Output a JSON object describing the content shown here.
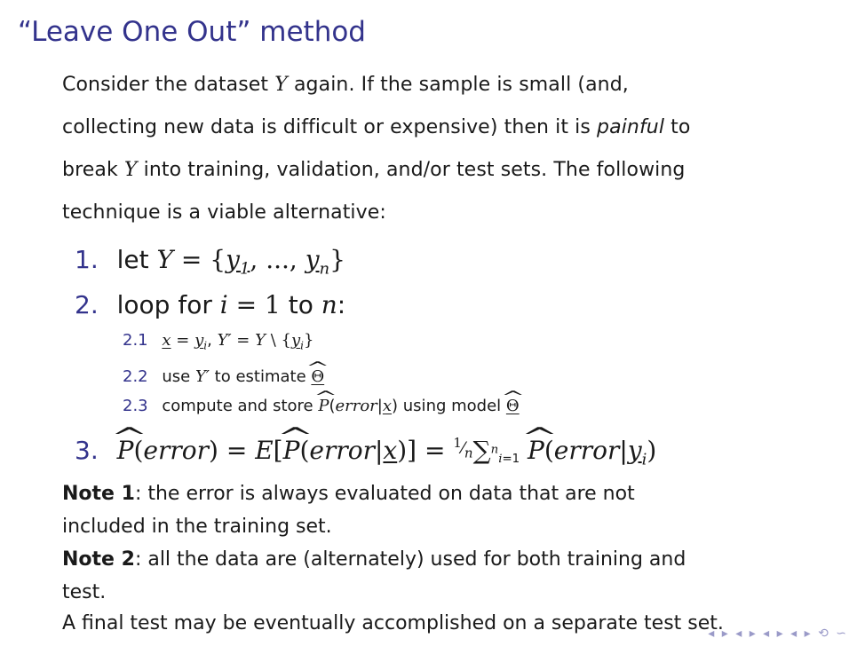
{
  "slide": {
    "title": "“Leave One Out” method",
    "intro_lines": [
      "Consider the dataset Y again. If the sample is small (and,",
      "collecting new data is difficult or expensive) then it is painful to",
      "break Y into training, validation, and/or test sets. The following",
      "technique is a viable alternative:"
    ],
    "steps": [
      {
        "number": "1.",
        "text_prefix": "let",
        "formula": "Y = {y1, ..., yn}"
      },
      {
        "number": "2.",
        "text_prefix": "loop for",
        "formula": "i = 1 to n:"
      },
      {
        "number": "3.",
        "text_prefix": "",
        "formula": "P̂(error) = E[P̂(error|x)] = 1/n Σ_{i=1}^{n} P̂(error|y_i)"
      }
    ],
    "substeps": [
      {
        "number": "2.1",
        "text": "x = y_i, Y′ = Y \\ {y_i}"
      },
      {
        "number": "2.2",
        "text": "use Y′ to estimate Θ̂"
      },
      {
        "number": "2.3",
        "text": "compute and store P̂(error|x) using model Θ̂"
      }
    ],
    "notes": [
      {
        "label": "Note 1",
        "text": ": the error is always evaluated on data that are not"
      },
      {
        "label": "",
        "text": "included in the training set."
      },
      {
        "label": "Note 2",
        "text": ": all the data are (alternately) used for both training and"
      },
      {
        "label": "",
        "text": "test."
      },
      {
        "label": "",
        "text": "A final test may be eventually accomplished on a separate test set."
      }
    ],
    "nav_symbols": "◂ ▸ ◂ ▸ ◂ ▸ ◂ ▸ ⟲ ∽"
  }
}
